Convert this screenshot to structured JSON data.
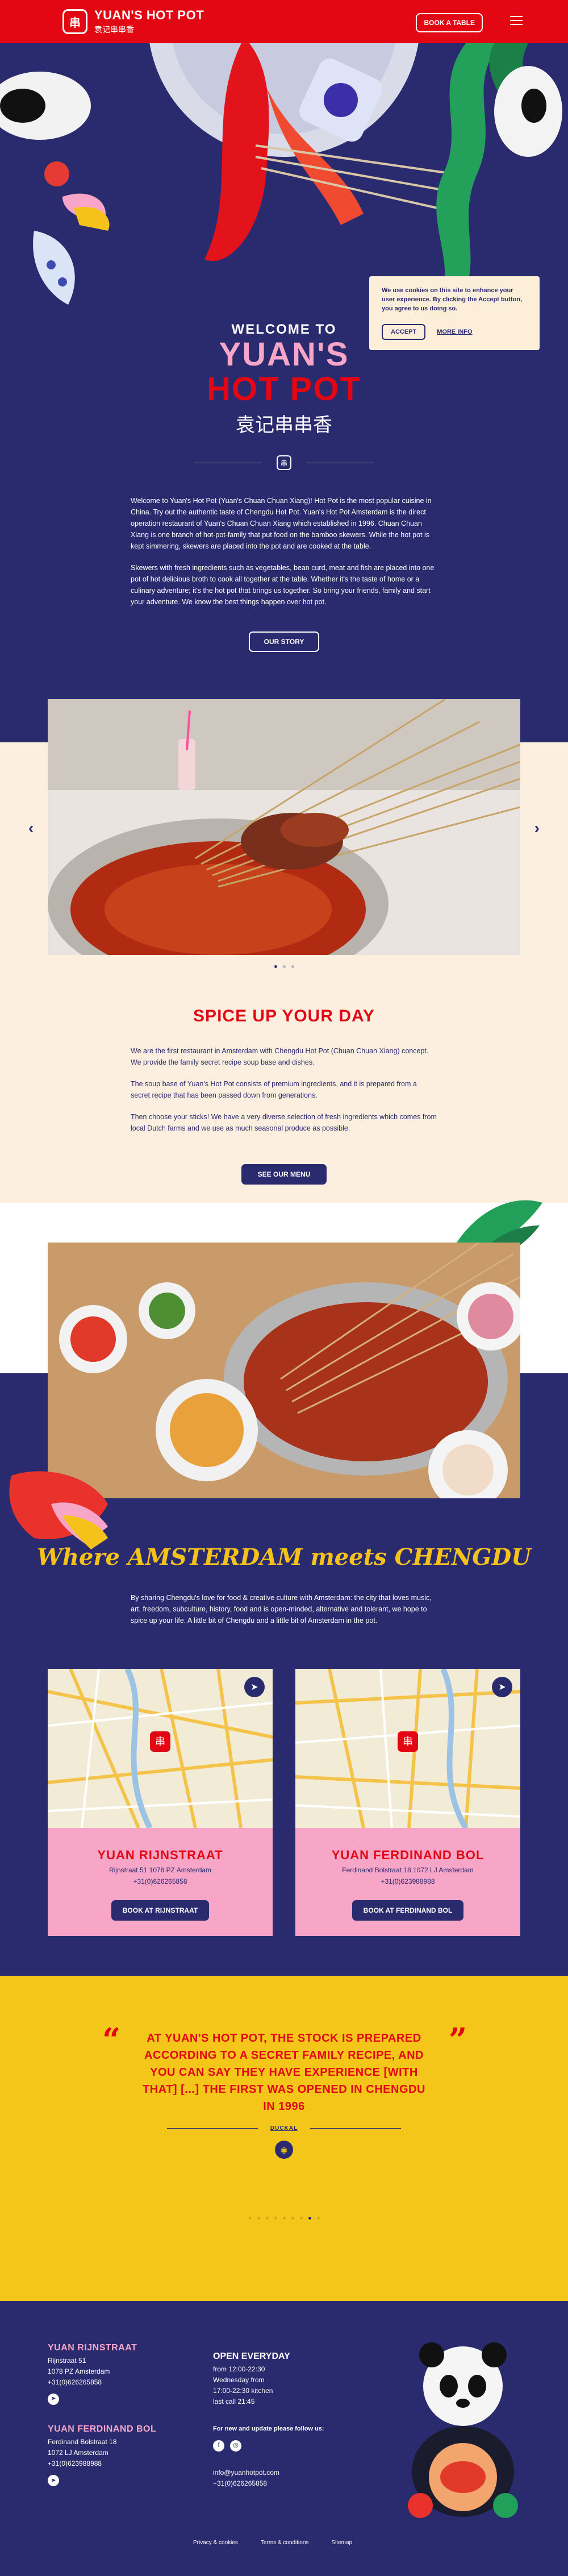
{
  "header": {
    "logo_mark": "串",
    "logo_name": "YUAN'S HOT POT",
    "logo_sub": "袁记串串香",
    "book_button": "BOOK A TABLE"
  },
  "cookie": {
    "message": "We use cookies on this site to enhance your user experience. By clicking the Accept button, you agree to us doing so.",
    "accept": "ACCEPT",
    "more": "MORE INFO"
  },
  "hero": {
    "welcome": "WELCOME TO",
    "title_line1": "YUAN'S",
    "title_line2": "HOT POT",
    "chinese": "袁记串串香",
    "emblem": "串",
    "paragraph1": "Welcome to Yuan's Hot Pot (Yuan's Chuan Chuan Xiang)! Hot Pot is the most popular cuisine in China. Try out the authentic taste of Chengdu Hot Pot. Yuan's Hot Pot Amsterdam is the direct operation restaurant of Yuan's Chuan Chuan Xiang which established in 1996. Chuan Chuan Xiang is one branch of hot-pot-family that put food on the bamboo skewers. While the hot pot is kept simmering, skewers are placed into the pot and are cooked at the table.",
    "paragraph2": "Skewers with fresh ingredients such as vegetables, bean curd, meat and fish are placed into one pot of hot delicious broth to cook all together at the table. Whether it's the taste of home or a culinary adventure; it's the hot pot that brings us together. So bring your friends, family and start your adventure. We know the best things happen over hot pot.",
    "story_button": "OUR STORY"
  },
  "slider": {
    "prev": "‹",
    "next": "›",
    "dots": 3,
    "active_dot": 0
  },
  "spice": {
    "title": "SPICE UP YOUR DAY",
    "paragraph1": "We are the first restaurant in Amsterdam with Chengdu Hot Pot (Chuan Chuan Xiang) concept. We provide the family secret recipe soup base and dishes.",
    "paragraph2": "The soup base of Yuan's Hot Pot consists of premium ingredients, and it is prepared from a secret recipe that has been passed down from generations.",
    "paragraph3": "Then choose your sticks! We have a very diverse selection of fresh ingredients which comes from local Dutch farms and we use as much seasonal produce as possible.",
    "menu_button": "SEE OUR MENU"
  },
  "amsterdam": {
    "title": "Where AMSTERDAM meets CHENGDU",
    "paragraph": "By sharing Chengdu's love for food & creative culture with Amsterdam: the city that loves music, art, freedom, subculture, history, food and is open-minded, alternative and tolerant, we hope to spice up your life. A little bit of Chengdu and a little bit of Amsterdam in the pot."
  },
  "locations": [
    {
      "name": "YUAN RIJNSTRAAT",
      "address": "Rijnstraat 51 1078 PZ Amsterdam",
      "phone": "+31(0)626265858",
      "button": "BOOK AT RIJNSTRAAT"
    },
    {
      "name": "YUAN FERDINAND BOL",
      "address": "Ferdinand Bolstraat 18 1072 LJ Amsterdam",
      "phone": "+31(0)623988988",
      "button": "BOOK AT FERDINAND BOL"
    }
  ],
  "quote": {
    "open": "“",
    "close": "”",
    "text": "AT YUAN'S HOT POT, THE STOCK IS PREPARED ACCORDING TO A SECRET FAMILY RECIPE, AND YOU CAN SAY THEY HAVE EXPERIENCE [WITH THAT] [...] THE FIRST WAS OPENED IN CHENGDU IN 1996",
    "author": "DUCKAL",
    "dots": 9,
    "active_dot": 7
  },
  "footer": {
    "loc1_name": "YUAN RIJNSTRAAT",
    "loc1_street": "Rijnstraat 51",
    "loc1_city": "1078 PZ Amsterdam",
    "loc1_phone": "+31(0)626265858",
    "loc2_name": "YUAN FERDINAND BOL",
    "loc2_street": "Ferdinand Bolstraat 18",
    "loc2_city": "1072 LJ Amsterdam",
    "loc2_phone": "+31(0)623988988",
    "hours_title": "OPEN EVERYDAY",
    "hours1": "from 12:00-22:30",
    "hours2": "Wednesday from",
    "hours3": "17:00-22:30 kitchen",
    "hours4": "last call 21:45",
    "follow": "For new and update please follow us:",
    "email": "info@yuanhotpot.com",
    "phone": "+31(0)626265858",
    "link_privacy": "Privacy & cookies",
    "link_terms": "Terms & conditions",
    "link_sitemap": "Sitemap"
  },
  "colors": {
    "red": "#e30613",
    "navy": "#2a2a6e",
    "pink": "#f7a6c8",
    "cream": "#fcefe0",
    "yellow": "#f4c619"
  }
}
